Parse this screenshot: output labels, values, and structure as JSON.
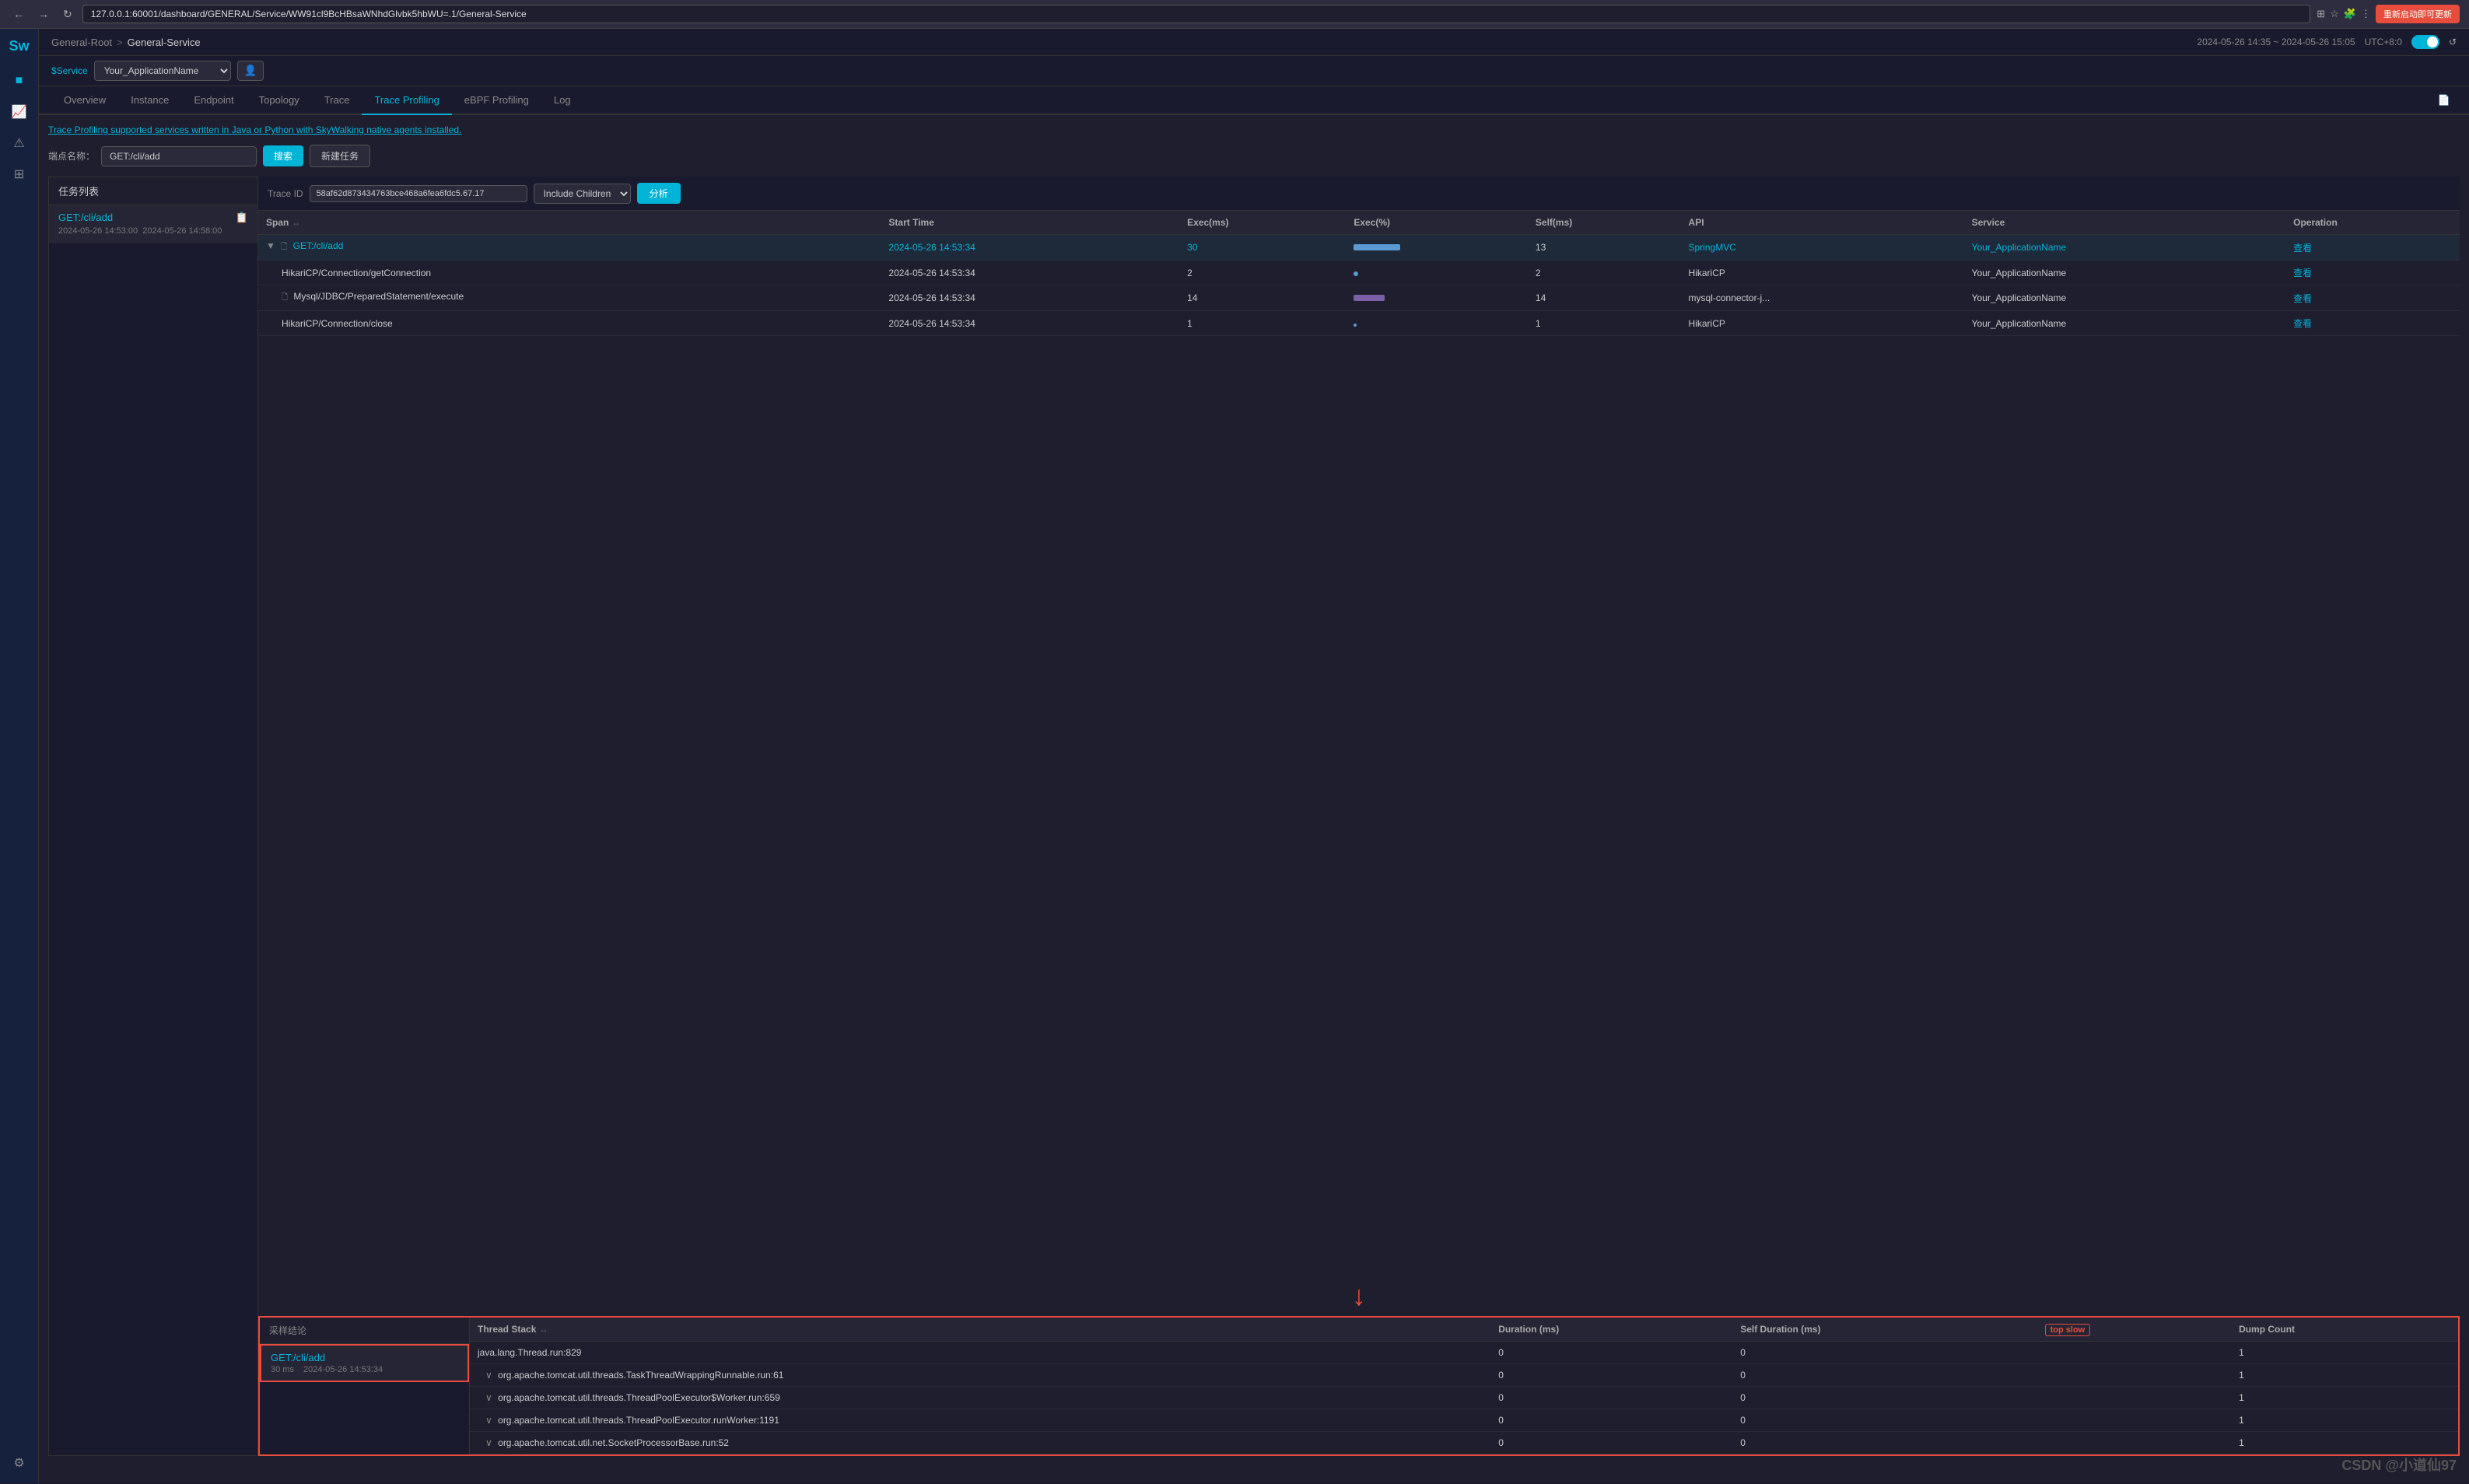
{
  "browser": {
    "url": "127.0.0.1:60001/dashboard/GENERAL/Service/WW91cl9BcHBsaWNhdGlvbk5hbWU=.1/General-Service",
    "restart_label": "重新启动即可更新"
  },
  "header": {
    "breadcrumb_root": "General-Root",
    "breadcrumb_sep": ">",
    "breadcrumb_current": "General-Service",
    "time_range": "2024-05-26 14:35 ~ 2024-05-26 15:05",
    "timezone": "UTC+8:0",
    "reload_icon": "↺"
  },
  "service_bar": {
    "label": "$Service",
    "value": "Your_ApplicationName"
  },
  "nav": {
    "tabs": [
      {
        "id": "overview",
        "label": "Overview"
      },
      {
        "id": "instance",
        "label": "Instance"
      },
      {
        "id": "endpoint",
        "label": "Endpoint"
      },
      {
        "id": "topology",
        "label": "Topology"
      },
      {
        "id": "trace",
        "label": "Trace"
      },
      {
        "id": "trace-profiling",
        "label": "Trace Profiling",
        "active": true
      },
      {
        "id": "ebpf-profiling",
        "label": "eBPF Profiling"
      },
      {
        "id": "log",
        "label": "Log"
      }
    ]
  },
  "page": {
    "info_banner": "Trace Profiling supported services written in Java or Python with SkyWalking native agents installed.",
    "search_label": "端点名称：",
    "search_value": "GET:/cli/add",
    "btn_search": "搜索",
    "btn_new_task": "新建任务"
  },
  "task_list": {
    "header": "任务列表",
    "items": [
      {
        "name": "GET:/cli/add",
        "time_start": "2024-05-26 14:53:00",
        "time_end": "2024-05-26 14:58:00",
        "active": true
      }
    ]
  },
  "trace_controls": {
    "trace_id_label": "Trace ID",
    "trace_id_value": "58af62d873434763bce468a6fea6fdc5.67.17",
    "include_children": "Include Children",
    "btn_analyze": "分析"
  },
  "trace_table": {
    "columns": [
      "Span",
      "",
      "Start Time",
      "Exec(ms)",
      "Exec(%)",
      "Self(ms)",
      "API",
      "Service",
      "Operation"
    ],
    "rows": [
      {
        "indent": 0,
        "expand": true,
        "icon": "page",
        "name": "GET:/cli/add",
        "highlight": true,
        "start_time": "2024-05-26 14:53:34",
        "exec_ms": "30",
        "exec_pct_bar": "50",
        "exec_pct_color": "#5b9bd5",
        "self_ms": "13",
        "api": "SpringMVC",
        "api_link": true,
        "service": "Your_ApplicationName",
        "service_link": true,
        "operation": "查看"
      },
      {
        "indent": 1,
        "expand": false,
        "icon": "",
        "name": "HikariCP/Connection/getConnection",
        "highlight": false,
        "start_time": "2024-05-26 14:53:34",
        "exec_ms": "2",
        "exec_pct_dot": true,
        "exec_pct_color": "#5b9bd5",
        "self_ms": "2",
        "api": "HikariCP",
        "service": "Your_ApplicationName",
        "operation": "查看"
      },
      {
        "indent": 1,
        "expand": false,
        "icon": "db",
        "name": "Mysql/JDBC/PreparedStatement/execute",
        "highlight": false,
        "start_time": "2024-05-26 14:53:34",
        "exec_ms": "14",
        "exec_pct_bar": "35",
        "exec_pct_color": "#7b5ea7",
        "self_ms": "14",
        "api": "mysql-connector-j...",
        "service": "Your_ApplicationName",
        "operation": "查看"
      },
      {
        "indent": 1,
        "expand": false,
        "icon": "",
        "name": "HikariCP/Connection/close",
        "highlight": false,
        "start_time": "2024-05-26 14:53:34",
        "exec_ms": "1",
        "exec_pct_dot": true,
        "exec_pct_color": "#5b9bd5",
        "self_ms": "1",
        "api": "HikariCP",
        "service": "Your_ApplicationName",
        "operation": "查看"
      }
    ]
  },
  "sampling": {
    "header": "采样结论",
    "items": [
      {
        "name": "GET:/cli/add",
        "duration": "30 ms",
        "time": "2024-05-26 14:53:34",
        "selected": true
      }
    ]
  },
  "thread_table": {
    "columns": [
      "Thread Stack",
      "",
      "Duration (ms)",
      "Self Duration (ms)",
      "top_slow_label",
      "Dump Count"
    ],
    "top_slow_label": "top slow",
    "rows": [
      {
        "indent": 0,
        "expand": false,
        "name": "java.lang.Thread.run:829",
        "duration": "0",
        "self_duration": "0",
        "dump_count": "1"
      },
      {
        "indent": 1,
        "expand": true,
        "name": "org.apache.tomcat.util.threads.TaskThreadWrappingRunnable.run:61",
        "duration": "0",
        "self_duration": "0",
        "dump_count": "1"
      },
      {
        "indent": 1,
        "expand": true,
        "name": "org.apache.tomcat.util.threads.ThreadPoolExecutor$Worker.run:659",
        "duration": "0",
        "self_duration": "0",
        "dump_count": "1"
      },
      {
        "indent": 1,
        "expand": true,
        "name": "org.apache.tomcat.util.threads.ThreadPoolExecutor.runWorker:1191",
        "duration": "0",
        "self_duration": "0",
        "dump_count": "1"
      },
      {
        "indent": 1,
        "expand": true,
        "name": "org.apache.tomcat.util.net.SocketProcessorBase.run:52",
        "duration": "0",
        "self_duration": "0",
        "dump_count": "1"
      }
    ]
  },
  "watermark": "CSDN @小道仙97"
}
